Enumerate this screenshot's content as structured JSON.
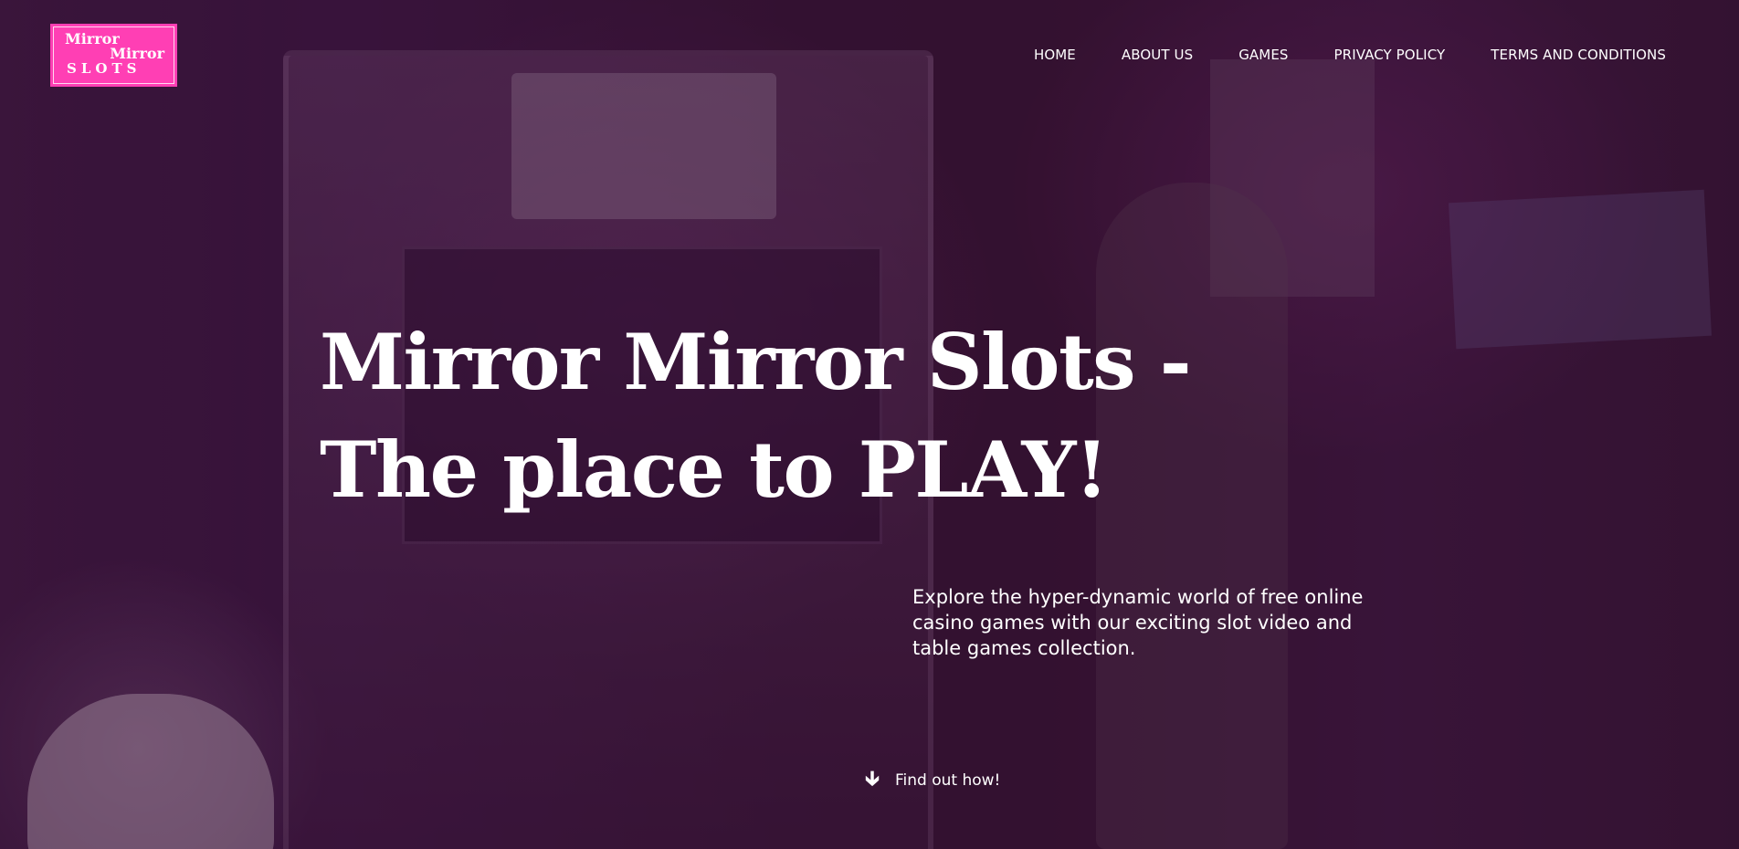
{
  "logo": {
    "line1": "Mirror",
    "line2": "Mirror",
    "line3": "SLOTS",
    "color": "#ff3fb4"
  },
  "nav": {
    "items": [
      {
        "label": "HOME"
      },
      {
        "label": "ABOUT US"
      },
      {
        "label": "GAMES"
      },
      {
        "label": "PRIVACY POLICY"
      },
      {
        "label": "TERMS AND CONDITIONS"
      }
    ]
  },
  "hero": {
    "headline": "Mirror Mirror Slots - The place to PLAY!",
    "subtext": "Explore the hyper-dynamic world of free online casino games with our exciting slot video and table games collection.",
    "cta_label": "Find out how!",
    "cta_icon": "arrow-down-icon"
  }
}
